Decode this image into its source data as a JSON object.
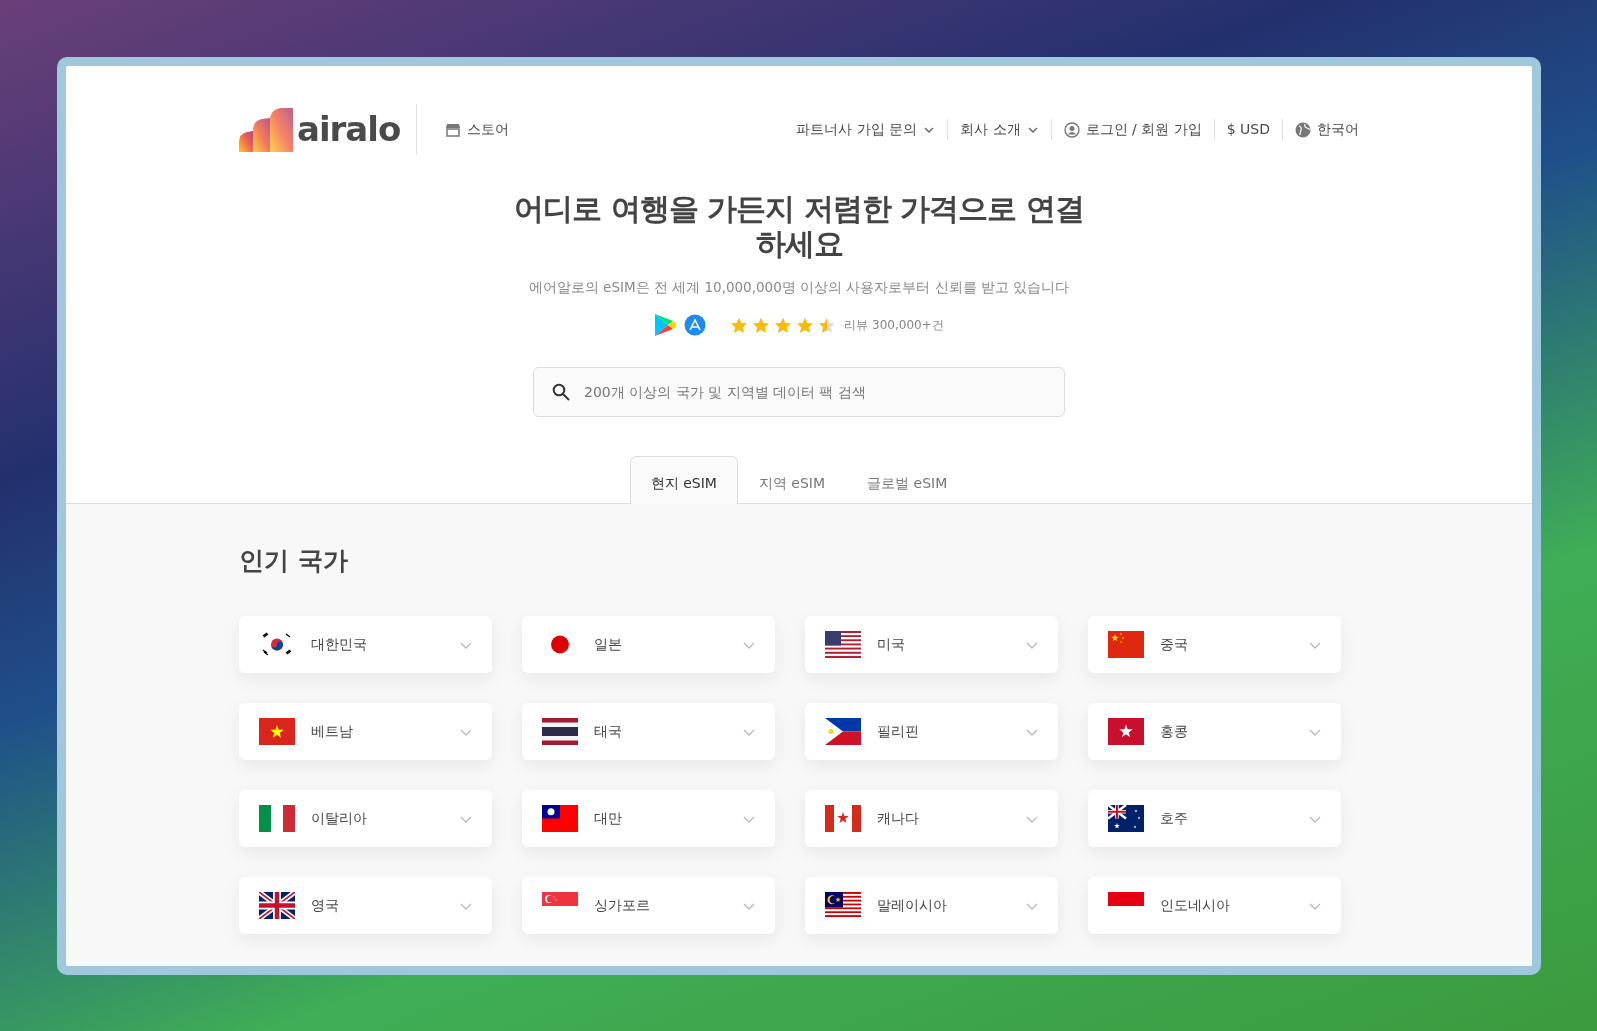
{
  "header": {
    "logo": "airalo",
    "store": "스토어",
    "nav": [
      {
        "label": "파트너사 가입 문의",
        "kind": "dropdown"
      },
      {
        "label": "회사 소개",
        "kind": "dropdown"
      },
      {
        "label": "로그인 / 회원 가입",
        "kind": "account"
      },
      {
        "label": "$ USD",
        "kind": "plain"
      },
      {
        "label": "한국어",
        "kind": "language"
      }
    ]
  },
  "hero": {
    "title": "어디로 여행을 가든지 저렴한 가격으로 연결하세요",
    "subtitle": "에어알로의 eSIM은 전 세계 10,000,000명 이상의 사용자로부터 신뢰를 받고 있습니다",
    "rating": {
      "stars": 4.5,
      "text": "리뷰 300,000+건"
    },
    "search": {
      "placeholder": "200개 이상의 국가 및 지역별 데이터 팩 검색"
    }
  },
  "tabs": [
    {
      "label": "현지 eSIM",
      "selected": true
    },
    {
      "label": "지역 eSIM",
      "selected": false
    },
    {
      "label": "글로벌 eSIM",
      "selected": false
    }
  ],
  "section_title": "인기 국가",
  "countries": [
    {
      "name": "대한민국",
      "kind": "kr"
    },
    {
      "name": "일본",
      "kind": "jp"
    },
    {
      "name": "미국",
      "kind": "us"
    },
    {
      "name": "중국",
      "kind": "cn"
    },
    {
      "name": "베트남",
      "kind": "vn"
    },
    {
      "name": "태국",
      "kind": "th"
    },
    {
      "name": "필리핀",
      "kind": "ph"
    },
    {
      "name": "홍콩",
      "kind": "hk"
    },
    {
      "name": "이탈리아",
      "kind": "it"
    },
    {
      "name": "대만",
      "kind": "tw"
    },
    {
      "name": "캐나다",
      "kind": "ca"
    },
    {
      "name": "호주",
      "kind": "au"
    },
    {
      "name": "영국",
      "kind": "gb"
    },
    {
      "name": "싱가포르",
      "kind": "sg"
    },
    {
      "name": "말레이시아",
      "kind": "my"
    },
    {
      "name": "인도네시아",
      "kind": "id"
    }
  ]
}
